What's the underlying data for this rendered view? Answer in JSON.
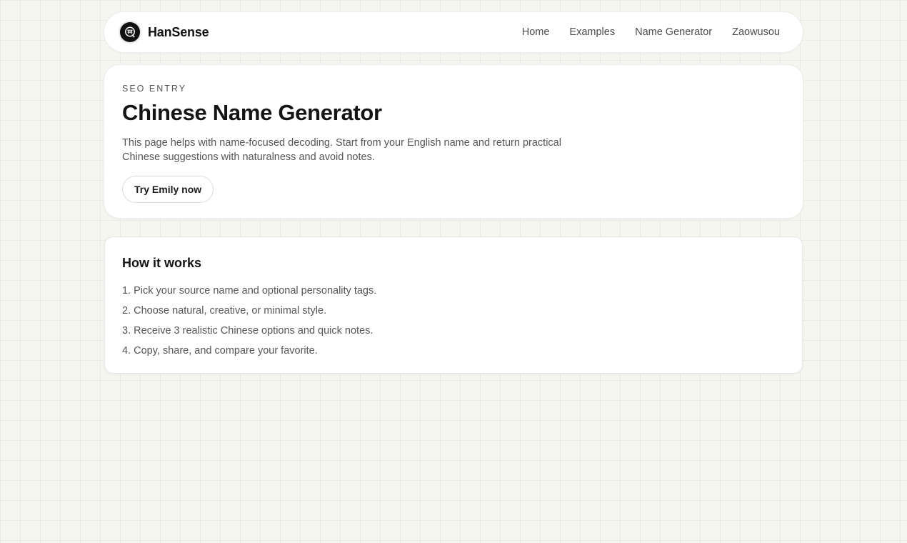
{
  "header": {
    "brand": "HanSense",
    "nav": [
      {
        "label": "Home"
      },
      {
        "label": "Examples"
      },
      {
        "label": "Name Generator"
      },
      {
        "label": "Zaowusou"
      }
    ]
  },
  "hero": {
    "eyebrow": "SEO ENTRY",
    "title": "Chinese Name Generator",
    "description": "This page helps with name-focused decoding. Start from your English name and return practical Chinese suggestions with naturalness and avoid notes.",
    "cta_label": "Try Emily now"
  },
  "how_it_works": {
    "title": "How it works",
    "steps": [
      "1. Pick your source name and optional personality tags.",
      "2. Choose natural, creative, or minimal style.",
      "3. Receive 3 realistic Chinese options and quick notes.",
      "4. Copy, share, and compare your favorite."
    ]
  },
  "icons": {
    "logo": "brand-logo-icon"
  },
  "colors": {
    "background": "#f6f6f1",
    "card": "#ffffff",
    "text": "#141414",
    "muted": "#555555"
  }
}
